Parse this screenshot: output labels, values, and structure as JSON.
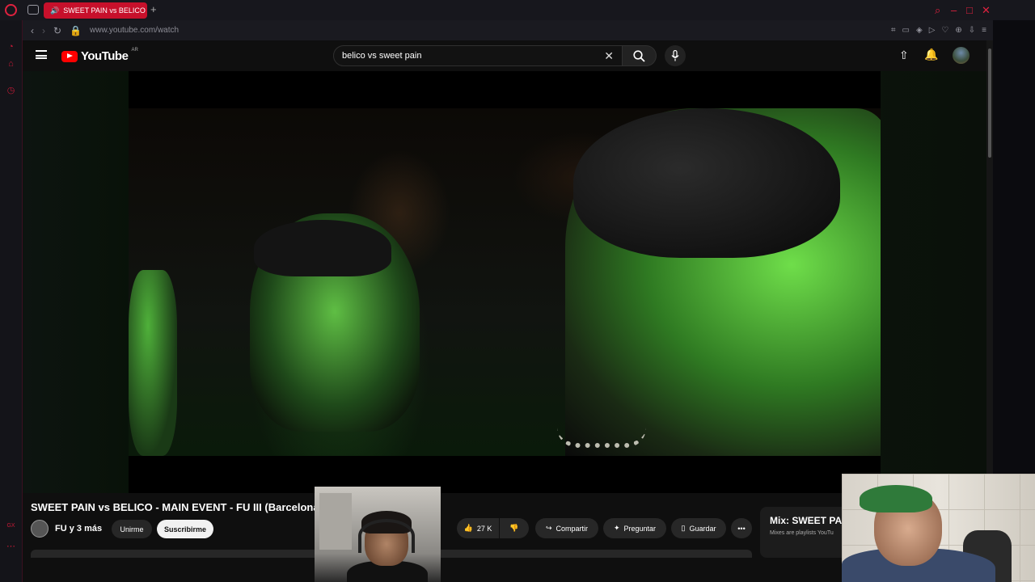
{
  "browser": {
    "tab_title": "SWEET PAIN vs BELICO",
    "url": "www.youtube.com/watch",
    "accent": "#e0223f"
  },
  "youtube": {
    "logo_text": "YouTube",
    "region": "AR",
    "search_value": "belico vs sweet pain"
  },
  "video": {
    "title": "SWEET PAIN vs BELICO - MAIN EVENT - FU III (Barcelona)",
    "channel": "FU y 3 más",
    "join_label": "Unirme",
    "subscribe_label": "Suscribirme",
    "likes": "27 K",
    "share_label": "Compartir",
    "ask_label": "Preguntar",
    "save_label": "Guardar"
  },
  "mix": {
    "title": "Mix: SWEET PA",
    "subtitle": "Mixes are playlists YouTu"
  }
}
